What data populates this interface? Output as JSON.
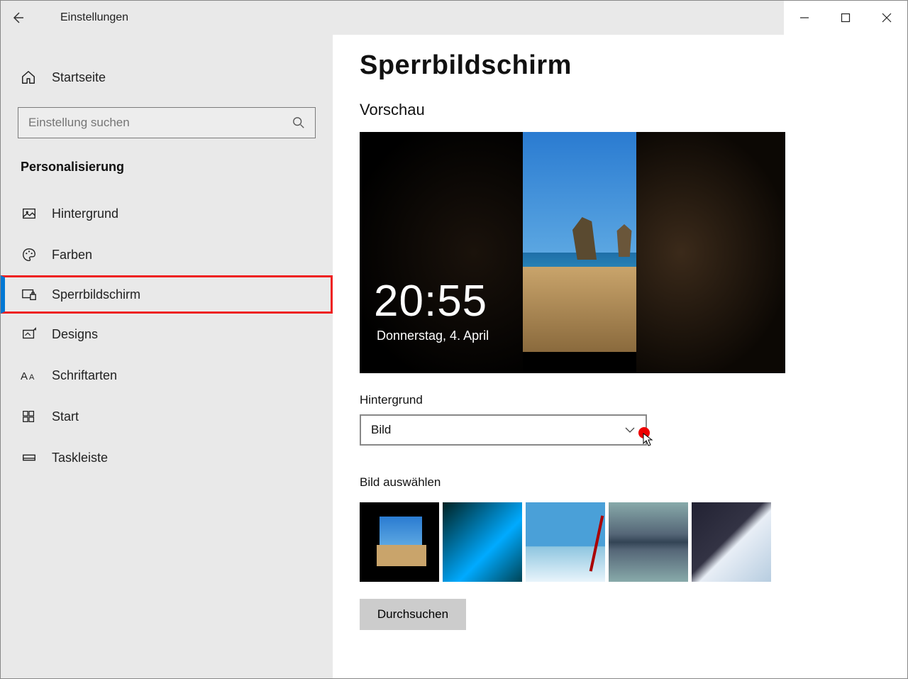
{
  "window": {
    "title": "Einstellungen"
  },
  "home": {
    "label": "Startseite"
  },
  "search": {
    "placeholder": "Einstellung suchen"
  },
  "category": "Personalisierung",
  "nav": {
    "items": [
      {
        "label": "Hintergrund"
      },
      {
        "label": "Farben"
      },
      {
        "label": "Sperrbildschirm"
      },
      {
        "label": "Designs"
      },
      {
        "label": "Schriftarten"
      },
      {
        "label": "Start"
      },
      {
        "label": "Taskleiste"
      }
    ]
  },
  "main": {
    "heading": "Sperrbildschirm",
    "preview_label": "Vorschau",
    "preview_time": "20:55",
    "preview_date": "Donnerstag, 4. April",
    "background_label": "Hintergrund",
    "background_value": "Bild",
    "choose_label": "Bild auswählen",
    "browse_label": "Durchsuchen"
  }
}
